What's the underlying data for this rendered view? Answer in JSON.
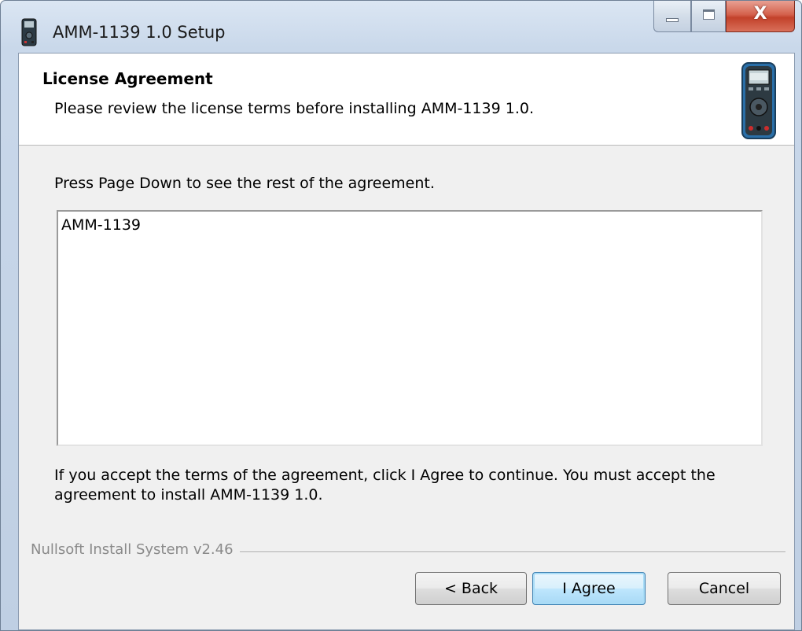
{
  "window": {
    "title": "AMM-1139 1.0 Setup",
    "app_icon": "multimeter-icon",
    "caption_buttons": [
      "minimize-icon",
      "maximize-icon",
      "close-icon"
    ],
    "close_glyph": "X"
  },
  "header": {
    "title": "License Agreement",
    "subtitle": "Please review the license terms before installing AMM-1139 1.0.",
    "icon": "multimeter-icon"
  },
  "main": {
    "instruction": "Press Page Down to see the rest of the agreement.",
    "license_text": "AMM-1139",
    "accept_text": "If you accept the terms of the agreement, click I Agree to continue. You must accept the agreement to install AMM-1139 1.0."
  },
  "footer": {
    "brand": "Nullsoft Install System v2.46",
    "back_label": "< Back",
    "agree_label": "I Agree",
    "cancel_label": "Cancel"
  },
  "colors": {
    "close_button": "#c2412a",
    "default_button_border": "#3c7fb1",
    "window_frame": "#c9d8ea",
    "dialog_background": "#f0f0f0"
  }
}
